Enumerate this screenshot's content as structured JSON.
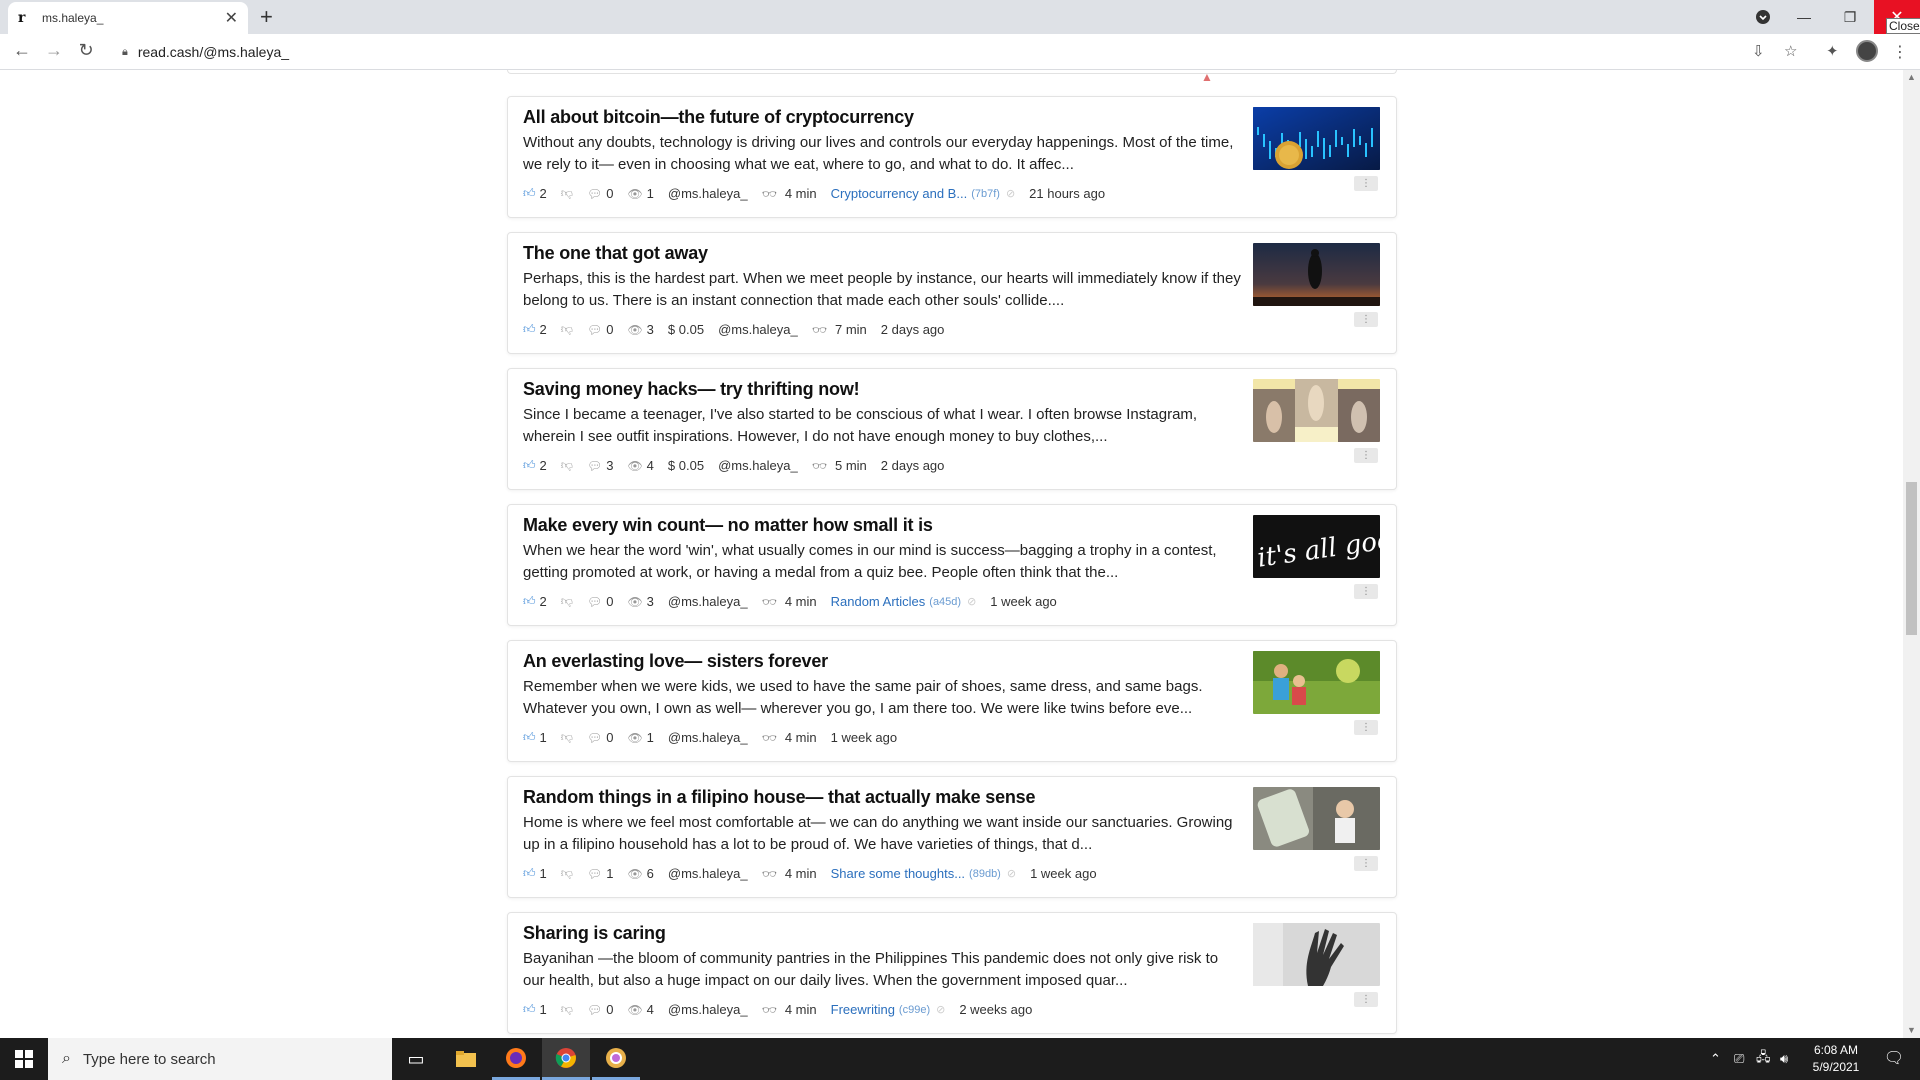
{
  "browser": {
    "tab_favicon": "r",
    "tab_title": "ms.haleya_",
    "tab_close": "✕",
    "new_tab": "+",
    "url": "read.cash/@ms.haleya_",
    "close_tooltip": "Close",
    "window_close_color": "#e81123"
  },
  "articles": [
    {
      "title": "All about bitcoin—the future of cryptocurrency",
      "excerpt": "Without any doubts, technology is driving our lives and controls our everyday happenings. Most of the time, we rely to it— even in choosing what we eat, where to go, and what to do. It affec...",
      "likes": "2",
      "comments": "0",
      "views": "1",
      "earned": "",
      "author": "@ms.haleya_",
      "read_time": "4 min",
      "community": "Cryptocurrency and B...",
      "community_id": "(7b7f)",
      "time": "21 hours ago",
      "thumb": "bitcoin-image"
    },
    {
      "title": "The one that got away",
      "excerpt": "Perhaps, this is the hardest part. When we meet people by instance, our hearts will immediately know if they belong to us. There is an instant connection that made each other souls' collide....",
      "likes": "2",
      "comments": "0",
      "views": "3",
      "earned": "$ 0.05",
      "author": "@ms.haleya_",
      "read_time": "7 min",
      "community": "",
      "community_id": "",
      "time": "2 days ago",
      "thumb": "sunset-couple-image"
    },
    {
      "title": "Saving money hacks— try thrifting now!",
      "excerpt": "Since I became a teenager, I've also started to be conscious of what I wear. I often browse Instagram, wherein I see outfit inspirations. However, I do not have enough money to buy clothes,...",
      "likes": "2",
      "comments": "3",
      "views": "4",
      "earned": "$ 0.05",
      "author": "@ms.haleya_",
      "read_time": "5 min",
      "community": "",
      "community_id": "",
      "time": "2 days ago",
      "thumb": "outfit-collage-image"
    },
    {
      "title": "Make every win count— no matter how small it is",
      "excerpt": "When we hear the word 'win', what usually comes in our mind is success—bagging a trophy in a contest, getting promoted at work, or having a medal from a quiz bee. People often think that the...",
      "likes": "2",
      "comments": "0",
      "views": "3",
      "earned": "",
      "author": "@ms.haleya_",
      "read_time": "4 min",
      "community": "Random Articles",
      "community_id": "(a45d)",
      "time": "1 week ago",
      "thumb": "its-all-good-image",
      "thumb_text": "it's all good"
    },
    {
      "title": "An everlasting love— sisters forever",
      "excerpt": "Remember when we were kids, we used to have the same pair of shoes, same dress, and same bags. Whatever you own, I own as well— wherever you go, I am there too. We were like twins before eve...",
      "likes": "1",
      "comments": "0",
      "views": "1",
      "earned": "",
      "author": "@ms.haleya_",
      "read_time": "4 min",
      "community": "",
      "community_id": "",
      "time": "1 week ago",
      "thumb": "kids-playing-image"
    },
    {
      "title": "Random things in a filipino house— that actually make sense",
      "excerpt": "Home is where we feel most comfortable at— we can do anything we want inside our sanctuaries. Growing up in a filipino household has a lot to be proud of. We have varieties of things, that d...",
      "likes": "1",
      "comments": "1",
      "views": "6",
      "earned": "",
      "author": "@ms.haleya_",
      "read_time": "4 min",
      "community": "Share some thoughts...",
      "community_id": "(89db)",
      "time": "1 week ago",
      "thumb": "filipino-house-image"
    },
    {
      "title": "Sharing is caring",
      "excerpt": "Bayanihan —the bloom of community pantries in the Philippines This pandemic does not only give risk to our health, but also a huge impact on our daily lives. When the government imposed quar...",
      "likes": "1",
      "comments": "0",
      "views": "4",
      "earned": "",
      "author": "@ms.haleya_",
      "read_time": "4 min",
      "community": "Freewriting",
      "community_id": "(c99e)",
      "time": "2 weeks ago",
      "thumb": "hand-shadow-image"
    }
  ],
  "taskbar": {
    "search_placeholder": "Type here to search",
    "time": "6:08 AM",
    "date": "5/9/2021"
  }
}
